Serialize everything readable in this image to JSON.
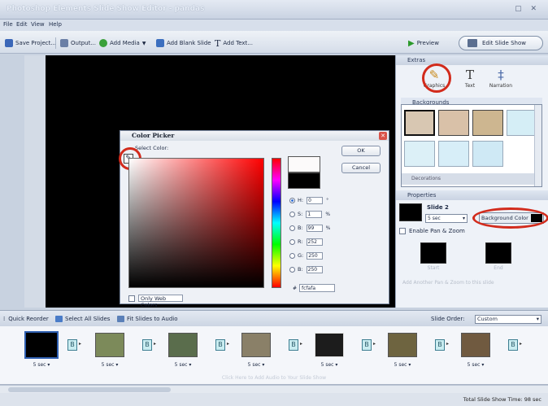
{
  "window": {
    "title": "Photoshop Elements Slide Show Editor - pandas",
    "controls": "▢ ✕"
  },
  "menu": [
    "File",
    "Edit",
    "View",
    "Help"
  ],
  "toolbar": {
    "save": "Save Project...",
    "output": "Output...",
    "add_media": "Add Media",
    "add_blank": "Add Blank Slide",
    "add_text": "Add Text...",
    "preview": "Preview",
    "edit_slideshow": "Edit Slide Show"
  },
  "extras": {
    "header": "Extras",
    "items": [
      {
        "label": "Graphics",
        "icon": "graphics-icon",
        "glyph": "✎"
      },
      {
        "label": "Text",
        "icon": "text-icon",
        "glyph": "T"
      },
      {
        "label": "Narration",
        "icon": "microphone-icon",
        "glyph": "‡"
      }
    ],
    "backgrounds_header": "Backgrounds",
    "category_footer": "Decorations",
    "thumb_colors": [
      "#d8c7b2",
      "#d9c1a8",
      "#cdb690",
      "#d5eef6",
      "#dcf0f7",
      "#d7eef8",
      "#cfe9f5"
    ]
  },
  "properties": {
    "header": "Properties",
    "slide_name": "Slide 2",
    "duration": "5 sec",
    "background_color_label": "Background Color",
    "enable_pan_zoom": "Enable Pan & Zoom",
    "start": "Start",
    "end": "End",
    "add_another": "Add Another Pan & Zoom to this slide"
  },
  "color_picker": {
    "title": "Color Picker",
    "select_label": "Select Color:",
    "ok": "OK",
    "cancel": "Cancel",
    "fields": [
      {
        "label": "H:",
        "value": "0",
        "unit": "°",
        "checked": true
      },
      {
        "label": "S:",
        "value": "1",
        "unit": "%",
        "checked": false
      },
      {
        "label": "B:",
        "value": "99",
        "unit": "%",
        "checked": false
      },
      {
        "label": "R:",
        "value": "252",
        "unit": "",
        "checked": false
      },
      {
        "label": "G:",
        "value": "250",
        "unit": "",
        "checked": false
      },
      {
        "label": "B:",
        "value": "250",
        "unit": "",
        "checked": false
      }
    ],
    "hex_prefix": "#",
    "hex": "fcfafa",
    "only_web": "Only Web Colors",
    "new_color": "#fcfafa",
    "current_color": "#000000"
  },
  "storyboard": {
    "quick_reorder": "Quick Reorder",
    "select_all": "Select All Slides",
    "fit_audio": "Fit Slides to Audio",
    "order_label": "Slide Order:",
    "order_value": "Custom",
    "audio_hint": "Click Here to Add Audio to Your Slide Show",
    "transition_letter": "B",
    "slides": [
      {
        "label": "5 sec ▾",
        "color": "#000000"
      },
      {
        "label": "5 sec ▾",
        "color": "#7c8a5a"
      },
      {
        "label": "5 sec ▾",
        "color": "#5a6d4c"
      },
      {
        "label": "5 sec ▾",
        "color": "#8a8068"
      },
      {
        "label": "5 sec ▾",
        "color": "#1c1c1c"
      },
      {
        "label": "5 sec ▾",
        "color": "#6e6440"
      },
      {
        "label": "5 sec ▾",
        "color": "#705a40"
      }
    ]
  },
  "status": {
    "total_time": "Total Slide Show Time: 98 sec"
  }
}
